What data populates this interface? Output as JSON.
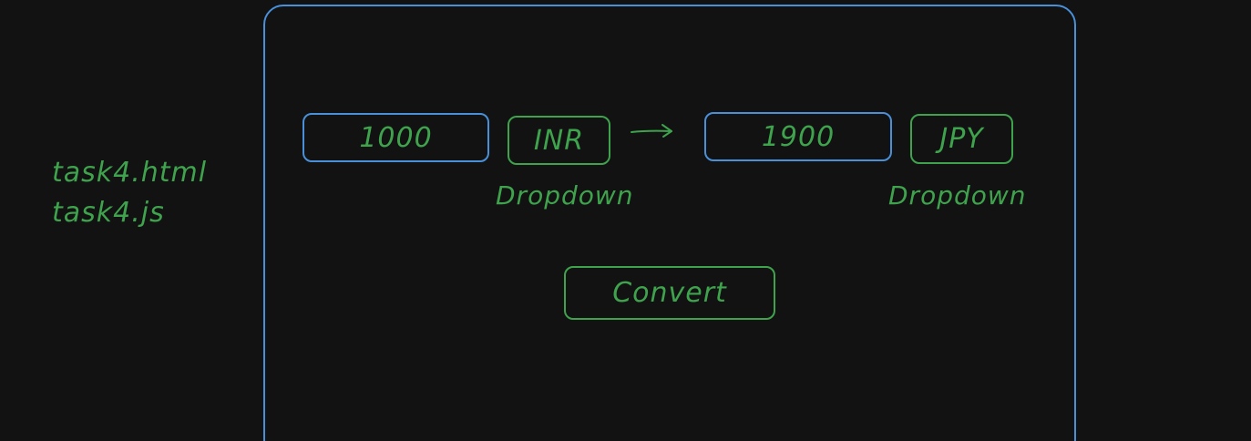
{
  "files": [
    "task4.html",
    "task4.js"
  ],
  "converter": {
    "from_amount": "1000",
    "from_currency": "INR",
    "from_dropdown_label": "Dropdown",
    "to_amount": "1900",
    "to_currency": "JPY",
    "to_dropdown_label": "Dropdown",
    "convert_label": "Convert"
  },
  "colors": {
    "background": "#121212",
    "frame_blue": "#4a90d9",
    "ink_green": "#3fa34d"
  }
}
